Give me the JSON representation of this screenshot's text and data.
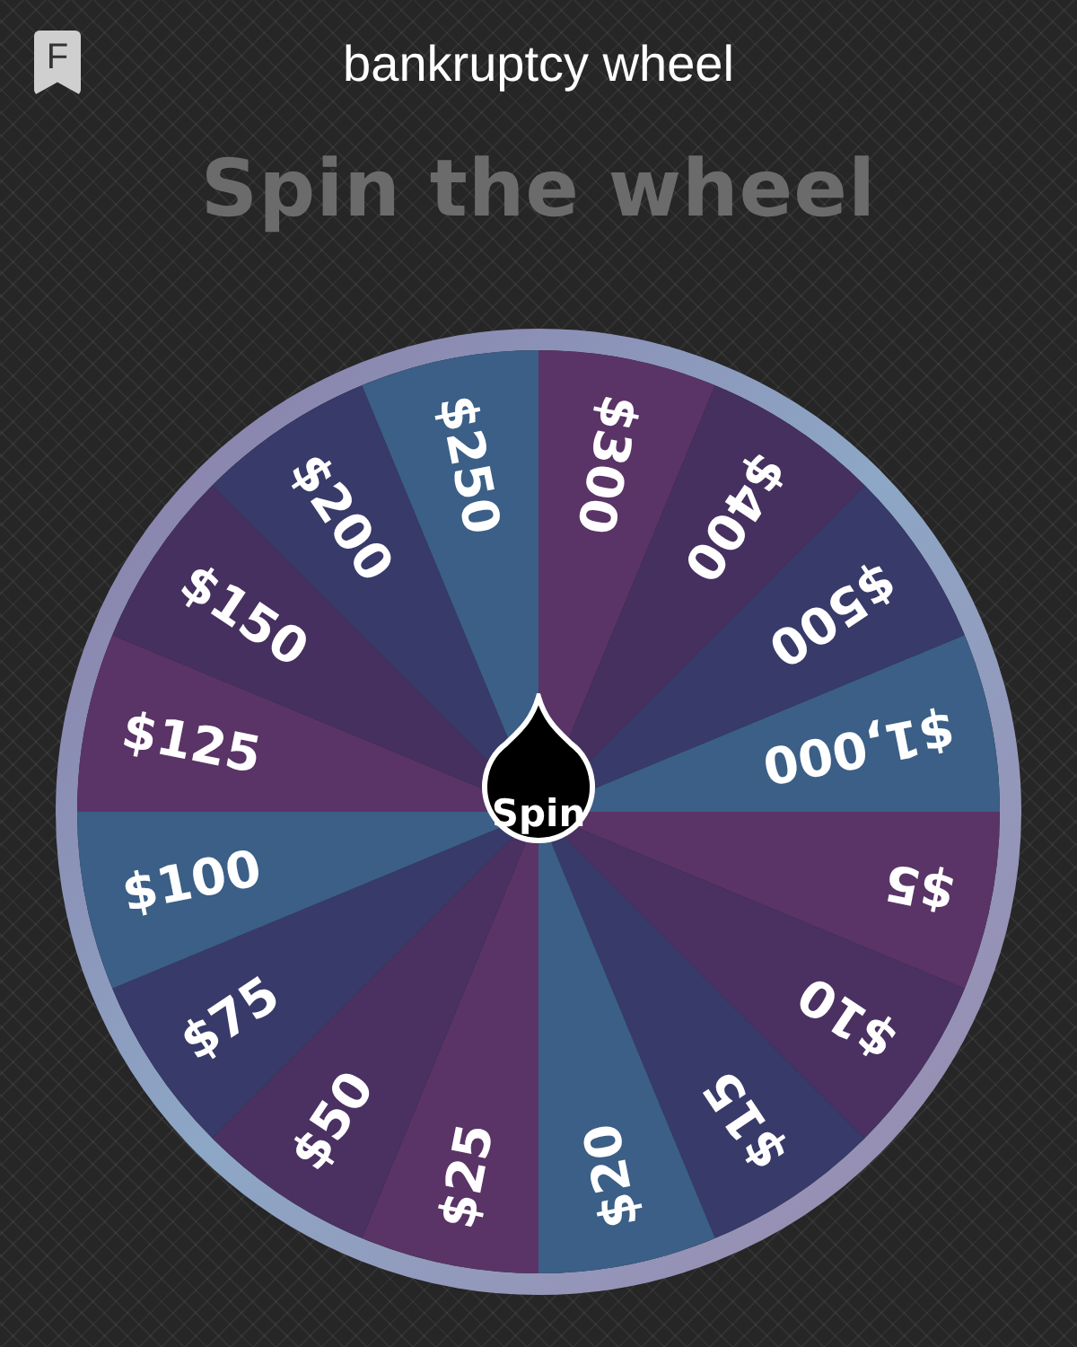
{
  "header": {
    "badge": "F",
    "title": "bankruptcy wheel"
  },
  "heading": "Spin the wheel",
  "wheel": {
    "segments": [
      {
        "label": "$300",
        "color": "#5a3466"
      },
      {
        "label": "$400",
        "color": "#46305f"
      },
      {
        "label": "$500",
        "color": "#383a69"
      },
      {
        "label": "$1,000",
        "color": "#3b5f86"
      },
      {
        "label": "$5",
        "color": "#5a3466"
      },
      {
        "label": "$10",
        "color": "#4a3162"
      },
      {
        "label": "$15",
        "color": "#383a69"
      },
      {
        "label": "$20",
        "color": "#3b5f86"
      },
      {
        "label": "$25",
        "color": "#5a3466"
      },
      {
        "label": "$50",
        "color": "#4a3162"
      },
      {
        "label": "$75",
        "color": "#383a69"
      },
      {
        "label": "$100",
        "color": "#3b5f86"
      },
      {
        "label": "$125",
        "color": "#5a3466"
      },
      {
        "label": "$150",
        "color": "#46305f"
      },
      {
        "label": "$200",
        "color": "#383a69"
      },
      {
        "label": "$250",
        "color": "#3b5f86"
      }
    ],
    "spin_button": "Spin"
  }
}
